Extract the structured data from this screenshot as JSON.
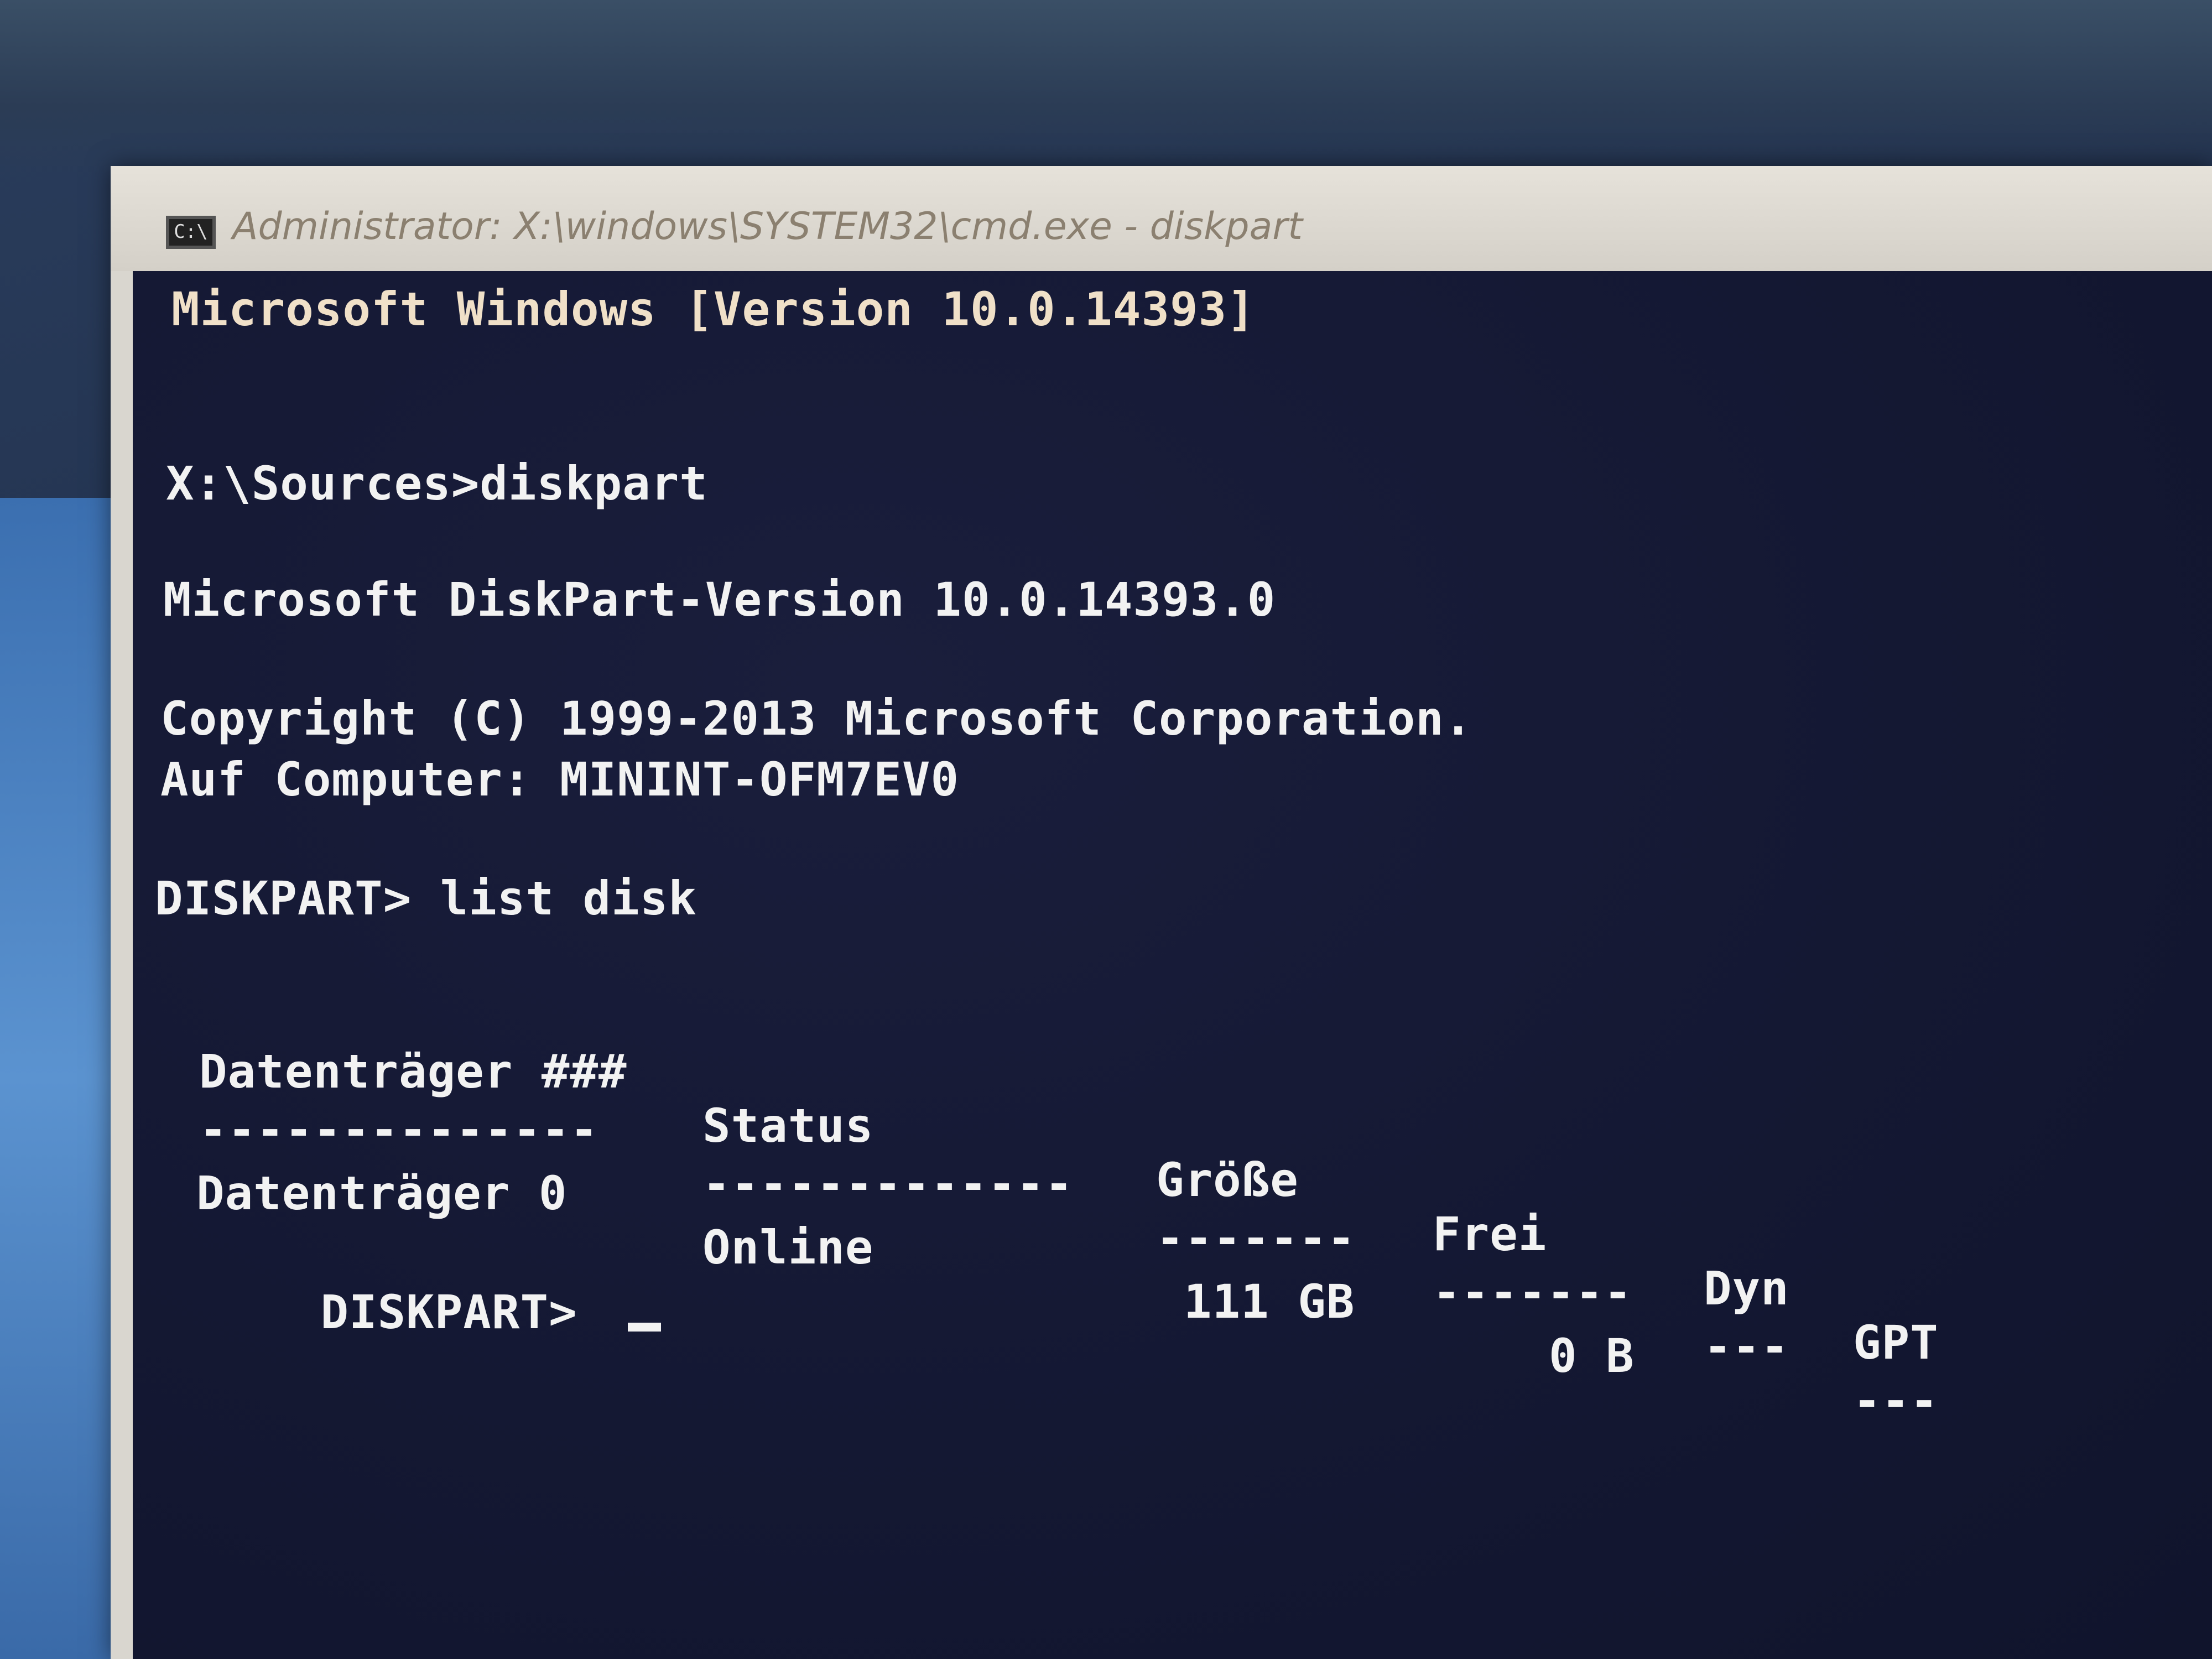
{
  "window": {
    "title": "Administrator: X:\\windows\\SYSTEM32\\cmd.exe - diskpart",
    "icon": "cmd-icon",
    "icon_glyph": "C:\\"
  },
  "console": {
    "line1": "Microsoft Windows [Version 10.0.14393]",
    "line2": "X:\\Sources>diskpart",
    "line3": "Microsoft DiskPart-Version 10.0.14393.0",
    "line4": "Copyright (C) 1999-2013 Microsoft Corporation.",
    "line5": "Auf Computer: MININT-OFM7EV0",
    "line6": "DISKPART> list disk",
    "prompt": "DISKPART> "
  },
  "table": {
    "headers": [
      "Datenträger ###",
      "Status",
      "Größe",
      "Frei",
      "Dyn",
      "GPT"
    ],
    "separators": [
      "--------------",
      "-------------",
      "-------",
      "-------",
      "---",
      "---"
    ],
    "rows": [
      [
        "Datenträger 0",
        "Online",
        "111 GB",
        "0 B",
        "",
        ""
      ]
    ]
  },
  "colors": {
    "console_bg": "#141833",
    "text": "#f2f2f2"
  }
}
